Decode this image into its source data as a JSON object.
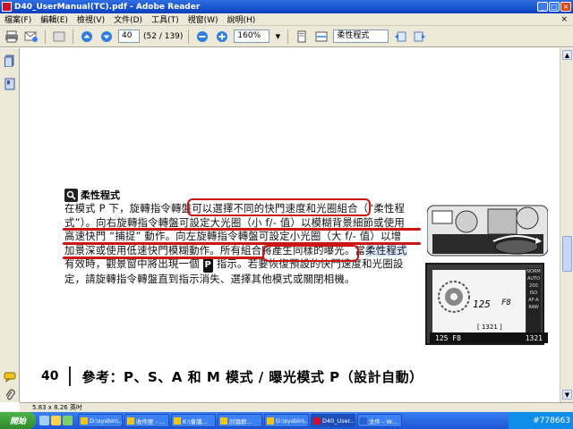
{
  "window": {
    "title": "D40_UserManual(TC).pdf - Adobe Reader",
    "controls": {
      "minimize": "_",
      "maximize": "□",
      "close": "×"
    }
  },
  "menu": {
    "items": [
      "檔案(F)",
      "編輯(E)",
      "檢視(V)",
      "文件(D)",
      "工具(T)",
      "視窗(W)",
      "說明(H)"
    ],
    "close": "×"
  },
  "toolbar": {
    "page_input": "40",
    "page_count": "(52 / 139)",
    "zoom": "160%",
    "find": "柔性程式"
  },
  "document": {
    "heading": "柔性程式",
    "lines": [
      "在模式 P 下，旋轉指令轉盤可以選擇不同的快門速度和光圈組合（“柔性程",
      "式”）。向右旋轉指令轉盤可設定大光圈（小 f/- 值）以模糊背景細節或使用",
      "高速快門 “捕捉” 動作。向左旋轉指令轉盤可設定小光圈（大 f/- 值）以增",
      "加景深或使用低速快門模糊動作。所有組合將產生同樣的曝光。當",
      "有效時，觀景窗中將出現一個",
      "指示。若要恢復預設的快門速度和光圈設",
      "定，請旋轉指令轉盤直到指示消失、選擇其他模式或關閉相機。"
    ],
    "highlight": "柔性程式",
    "p_icon": "P",
    "lcd": {
      "shutter": "125",
      "aperture": "F8",
      "side_labels": [
        "NORM",
        "AUTO",
        "200",
        "ISO",
        "AF-A",
        "RAW"
      ],
      "status": "[ 1321 ]"
    },
    "viewfinder": {
      "left": "125  F8",
      "right": "1321"
    },
    "page_number": "40",
    "footer_title": "參考：P、S、A 和 M 模式 / 曝光模式 P（設計自動）"
  },
  "status": {
    "page_size": "5.83 x 8.26 英吋"
  },
  "taskbar": {
    "start": "開始",
    "tasks": [
      "D:\\sysbin\\...",
      "收件匣 - ...",
      "K:\\會議...",
      "討論群...",
      "G:\\sysbin\\...",
      "D40_User...",
      "文件 - W..."
    ],
    "tray_text": "#778663"
  }
}
